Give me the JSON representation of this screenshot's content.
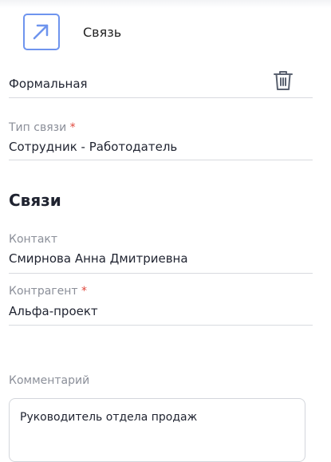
{
  "header": {
    "title": "Связь",
    "icon": "arrow-up-right-icon",
    "accent": "#6e94ee"
  },
  "relation": {
    "kind_value": "Формальная",
    "delete_icon": "trash-icon"
  },
  "link_type": {
    "label": "Тип связи",
    "required_mark": "*",
    "value": "Сотрудник - Работодатель"
  },
  "links_section": {
    "title": "Связи",
    "contact": {
      "label": "Контакт",
      "value": "Смирнова Анна Дмитриевна"
    },
    "counterparty": {
      "label": "Контрагент",
      "required_mark": "*",
      "value": "Альфа-проект"
    }
  },
  "comment": {
    "label": "Комментарий",
    "value": "Руководитель отдела продаж"
  }
}
